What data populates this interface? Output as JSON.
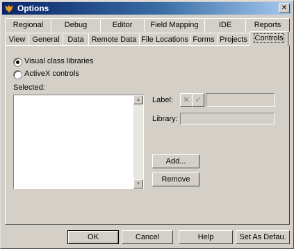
{
  "window": {
    "title": "Options"
  },
  "tabs_back": [
    {
      "label": "Regional"
    },
    {
      "label": "Debug"
    },
    {
      "label": "Editor"
    },
    {
      "label": "Field Mapping"
    },
    {
      "label": "IDE"
    },
    {
      "label": "Reports"
    }
  ],
  "tabs_front": [
    {
      "label": "View"
    },
    {
      "label": "General"
    },
    {
      "label": "Data"
    },
    {
      "label": "Remote Data"
    },
    {
      "label": "File Locations"
    },
    {
      "label": "Forms"
    },
    {
      "label": "Projects"
    },
    {
      "label": "Controls"
    }
  ],
  "active_tab": "Controls",
  "controls": {
    "radio_visual": {
      "label": "Visual class libraries",
      "checked": true
    },
    "radio_activex": {
      "label": "ActiveX controls",
      "checked": false
    },
    "selected_label": "Selected:",
    "label_field_label": "Label:",
    "library_label": "Library:",
    "label_value": "",
    "library_value": "",
    "add_button": "Add...",
    "remove_button": "Remove"
  },
  "footer": {
    "ok": "OK",
    "cancel": "Cancel",
    "help": "Help",
    "set_default": "Set As Defau."
  },
  "colors": {
    "title_start": "#0a246a",
    "title_end": "#a6caf0",
    "face": "#d4d0c8"
  }
}
